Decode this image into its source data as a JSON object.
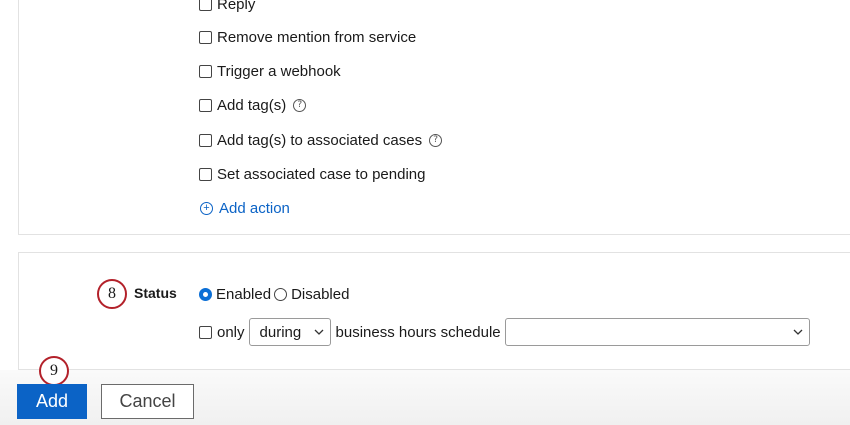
{
  "actions": {
    "items": [
      {
        "label": "Reply",
        "help": false
      },
      {
        "label": "Remove mention from service",
        "help": false
      },
      {
        "label": "Trigger a webhook",
        "help": false
      },
      {
        "label": "Add tag(s)",
        "help": true
      },
      {
        "label": "Add tag(s) to associated cases",
        "help": true
      },
      {
        "label": "Set associated case to pending",
        "help": false
      }
    ],
    "help_glyph": "?",
    "add_action_label": "Add action",
    "add_action_glyph": "+"
  },
  "status": {
    "step_number": "8",
    "label": "Status",
    "enabled_label": "Enabled",
    "disabled_label": "Disabled",
    "selected": "Enabled",
    "only_label": "only",
    "during_value": "during",
    "business_hours_label": "business hours schedule",
    "schedule_value": ""
  },
  "footer": {
    "step_number": "9",
    "add_label": "Add",
    "cancel_label": "Cancel"
  },
  "colors": {
    "accent": "#0b63c6",
    "step_marker_border": "#b3212a"
  }
}
